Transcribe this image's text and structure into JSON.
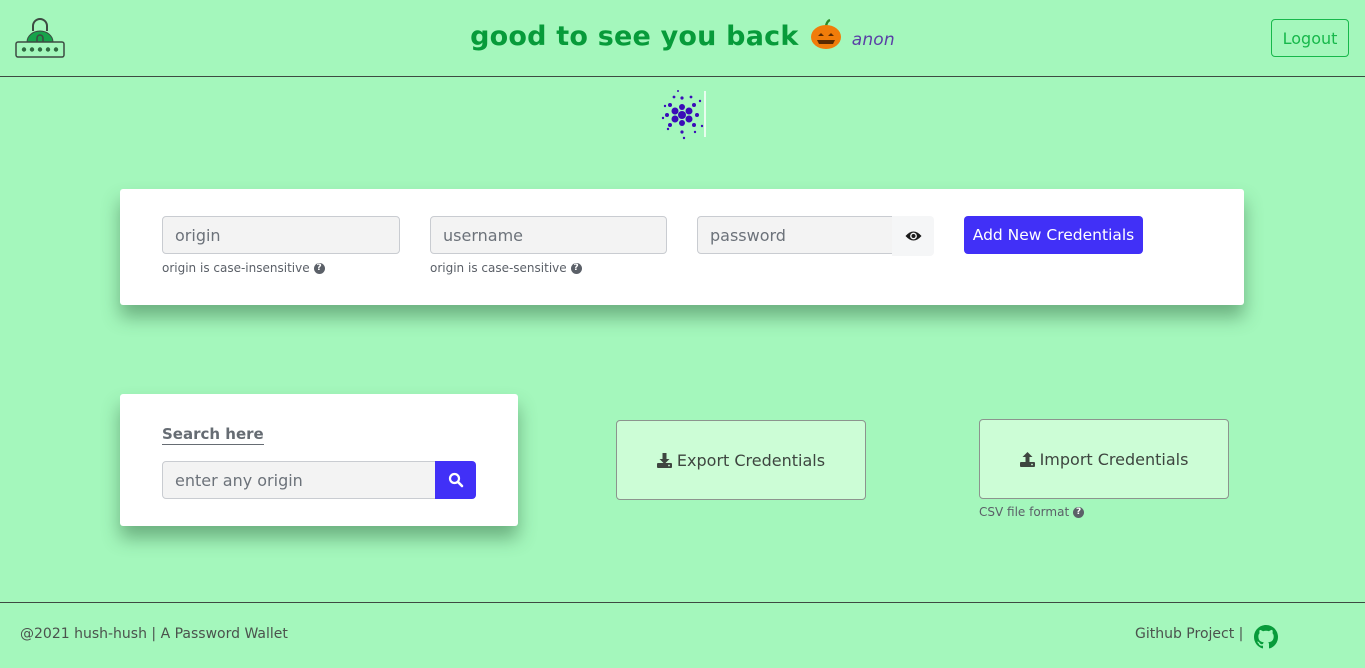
{
  "header": {
    "logo_icon": "lock-password-icon",
    "greeting": "good to see you back",
    "emoji_icon": "pumpkin-icon",
    "username": "anon",
    "logout_label": "Logout"
  },
  "loader": {
    "icon": "dots-spinner-icon"
  },
  "add_form": {
    "origin": {
      "placeholder": "origin",
      "value": "",
      "hint": "origin is case-insensitive"
    },
    "username": {
      "placeholder": "username",
      "value": "",
      "hint": "origin is case-sensitive"
    },
    "password": {
      "placeholder": "password",
      "value": "",
      "toggle_icon": "eye-icon"
    },
    "submit_label": "Add New Credentials"
  },
  "search": {
    "label": "Search here",
    "placeholder": "enter any origin",
    "value": "",
    "button_icon": "search-icon"
  },
  "export": {
    "label": "Export Credentials",
    "icon": "download-icon"
  },
  "import": {
    "label": "Import Credentials",
    "icon": "upload-icon",
    "hint": "CSV file format"
  },
  "footer": {
    "copyright": "@2021 hush-hush | A Password Wallet",
    "github_label": "Github Project |",
    "github_icon": "github-icon"
  },
  "colors": {
    "background": "#a4f7bc",
    "brand_green": "#079b3a",
    "primary_button": "#4130f7",
    "io_button_bg": "#ccfdd6"
  }
}
